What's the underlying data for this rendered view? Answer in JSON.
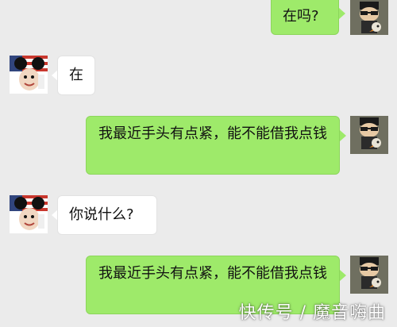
{
  "chat": {
    "messages": [
      {
        "sender": "me",
        "text": "在吗?"
      },
      {
        "sender": "other",
        "text": "在"
      },
      {
        "sender": "me",
        "text": "我最近手头有点紧，能不能借我点钱"
      },
      {
        "sender": "other",
        "text": "你说什么?"
      },
      {
        "sender": "me",
        "text": "我最近手头有点紧，能不能借我点钱"
      }
    ]
  },
  "colors": {
    "background": "#ebebeb",
    "outgoing_bubble": "#9eea6a",
    "incoming_bubble": "#ffffff"
  },
  "watermark": {
    "text": "快传号 / 魔音嗨曲"
  }
}
